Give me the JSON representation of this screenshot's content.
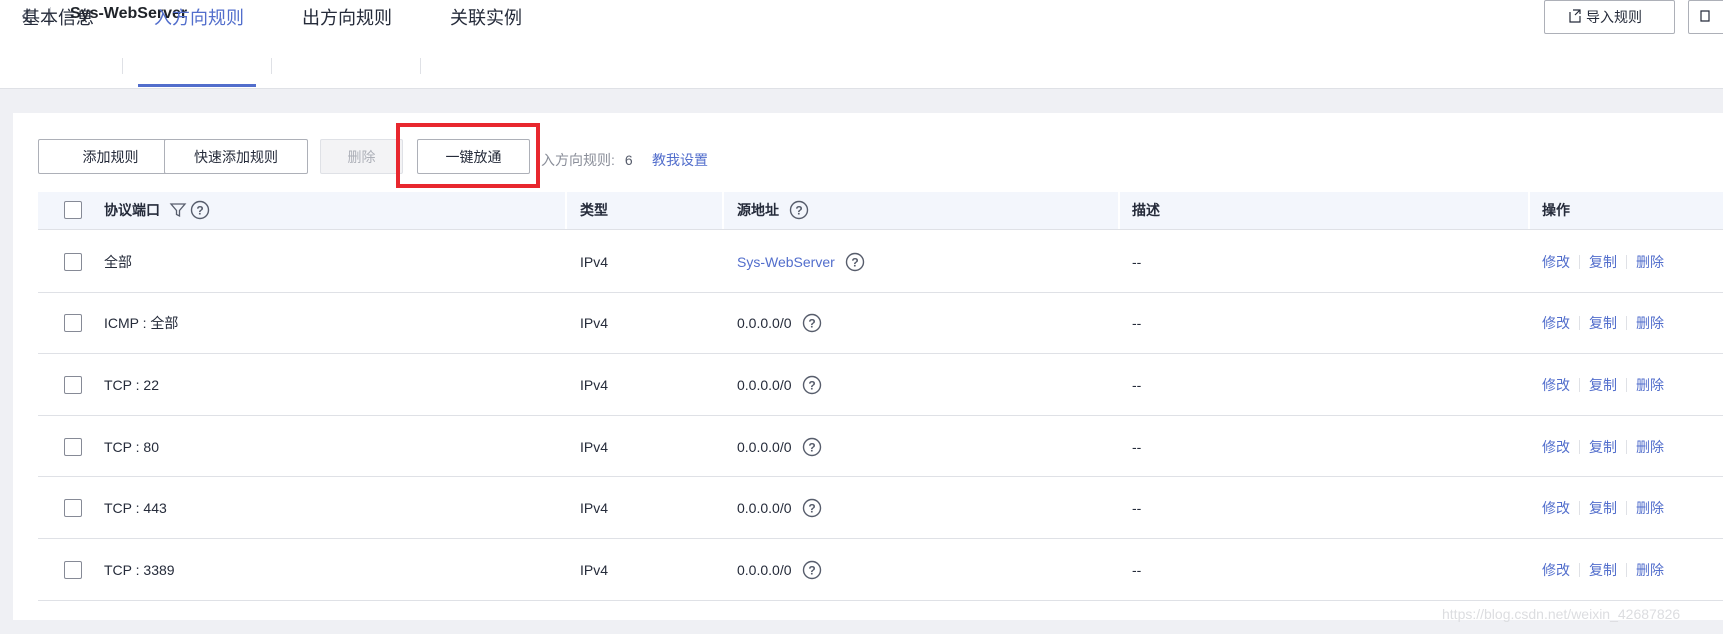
{
  "header": {
    "title": "Sys-WebServer",
    "import_label": "导入规则",
    "tabs": [
      {
        "label": "基本信息",
        "active": false
      },
      {
        "label": "入方向规则",
        "active": true
      },
      {
        "label": "出方向规则",
        "active": false
      },
      {
        "label": "关联实例",
        "active": false
      }
    ]
  },
  "toolbar": {
    "add_rule": "添加规则",
    "quick_add_rule": "快速添加规则",
    "delete": "删除",
    "one_click_open": "一键放通",
    "rule_count_label": "入方向规则:",
    "rule_count": "6",
    "teach_link": "教我设置"
  },
  "table": {
    "columns": [
      "协议端口",
      "类型",
      "源地址",
      "描述",
      "操作"
    ],
    "rows": [
      {
        "protocol": "全部",
        "type": "IPv4",
        "source": "Sys-WebServer",
        "source_is_link": true,
        "description": "--"
      },
      {
        "protocol": "ICMP : 全部",
        "type": "IPv4",
        "source": "0.0.0.0/0",
        "source_is_link": false,
        "description": "--"
      },
      {
        "protocol": "TCP : 22",
        "type": "IPv4",
        "source": "0.0.0.0/0",
        "source_is_link": false,
        "description": "--"
      },
      {
        "protocol": "TCP : 80",
        "type": "IPv4",
        "source": "0.0.0.0/0",
        "source_is_link": false,
        "description": "--"
      },
      {
        "protocol": "TCP : 443",
        "type": "IPv4",
        "source": "0.0.0.0/0",
        "source_is_link": false,
        "description": "--"
      },
      {
        "protocol": "TCP : 3389",
        "type": "IPv4",
        "source": "0.0.0.0/0",
        "source_is_link": false,
        "description": "--"
      }
    ],
    "actions": [
      "修改",
      "复制",
      "删除"
    ]
  },
  "watermark": "https://blog.csdn.net/weixin_42687826",
  "colors": {
    "accent": "#526ecc",
    "highlight": "#e8272e"
  },
  "icons": [
    "back-icon",
    "import-icon",
    "filter-icon",
    "help-icon"
  ]
}
